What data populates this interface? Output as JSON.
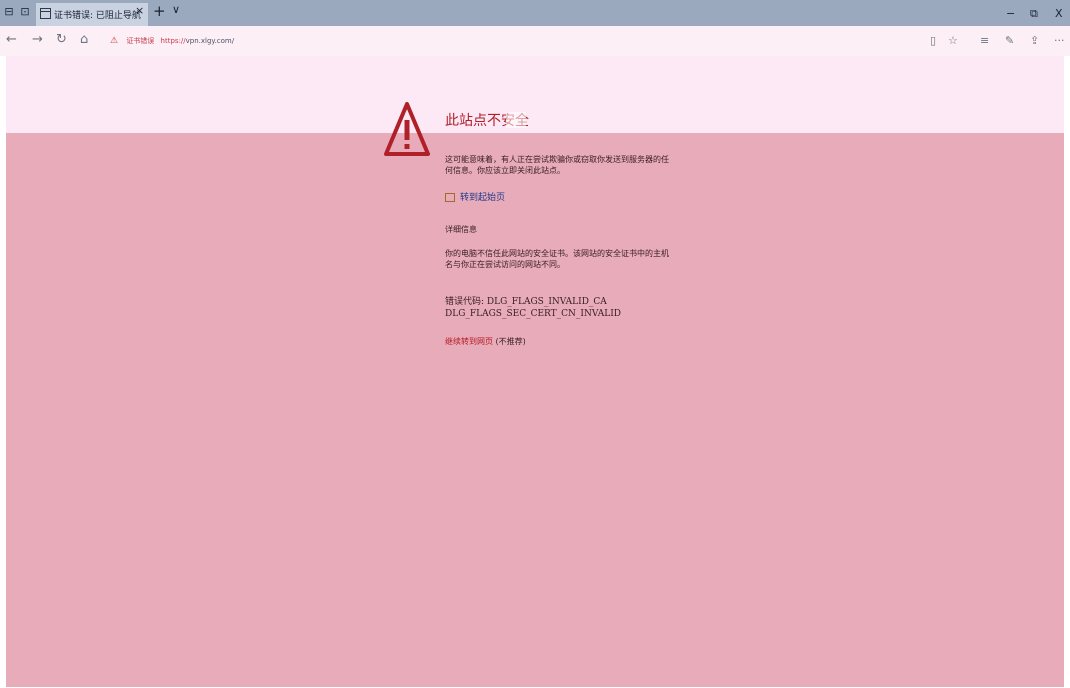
{
  "tabbar": {
    "active_tab_title": "证书错误: 已阻止导航",
    "close_glyph": "×",
    "new_tab_glyph": "+",
    "tabs_menu_glyph": "∨",
    "minimize_glyph": "−",
    "restore_glyph": "⧉",
    "close_window_glyph": "X"
  },
  "navbar": {
    "back_glyph": "←",
    "forward_glyph": "→",
    "refresh_glyph": "↻",
    "home_glyph": "⌂",
    "cert_error_label": "证书错误",
    "url_protocol": "https://",
    "url_rest": "vpn.xlgy.com/",
    "more_glyph": "···"
  },
  "page": {
    "heading": "此站点不安全",
    "paragraph1": "这可能意味着，有人正在尝试欺骗你或窃取你发送到服务器的任何信息。你应该立即关闭此站点。",
    "goto_start_label": "转到起始页",
    "details_label": "详细信息",
    "paragraph2": "你的电脑不信任此网站的安全证书。该网站的安全证书中的主机名与你正在尝试访问的网站不同。",
    "error_code_line1": "错误代码: DLG_FLAGS_INVALID_CA",
    "error_code_line2": "DLG_FLAGS_SEC_CERT_CN_INVALID",
    "continue_link": "继续转到网页",
    "continue_note": " (不推荐)"
  },
  "icons": {
    "warning": "warning-triangle-icon",
    "accent_warning_color": "#b02028"
  }
}
